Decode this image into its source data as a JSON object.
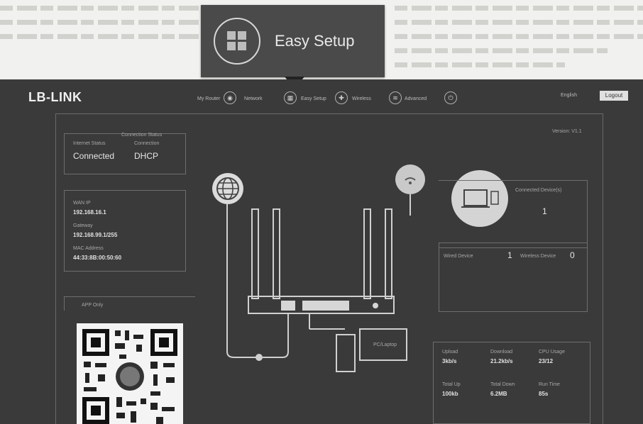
{
  "callout": {
    "label": "Easy Setup"
  },
  "app": {
    "logo": "LB-LINK",
    "nav": [
      {
        "label": "My Router",
        "icon": "router-icon"
      },
      {
        "label": "Network",
        "icon": "network-icon"
      },
      {
        "label": "Easy Setup",
        "icon": "easy-setup-icon"
      },
      {
        "label": "Wireless",
        "icon": "wireless-icon"
      },
      {
        "label": "Advanced",
        "icon": "advanced-icon"
      },
      {
        "label": "Logout",
        "icon": "power-icon"
      }
    ],
    "header_right": "English",
    "lang_button": "Logout"
  },
  "dashboard": {
    "version": "Version: V1.1",
    "internet": {
      "heading": "Connection Status",
      "status_label": "Internet Status",
      "status_value": "Connected",
      "type_label": "Connection",
      "type_value": "DHCP"
    },
    "wan": {
      "ip_label": "WAN IP",
      "ip_value": "192.168.16.1",
      "gateway_label": "Gateway",
      "gateway_value": "192.168.99.1/255",
      "mac_label": "MAC Address",
      "mac_value": "44:33:8B:00:50:60"
    },
    "qr_label": "APP Only",
    "clients": {
      "label": "Connected Device(s)",
      "count": "1"
    },
    "wired": {
      "label": "Wired Device",
      "count": "1",
      "label2": "Wireless Device",
      "count2": "0"
    },
    "stats": {
      "a_label": "Upload",
      "a_value": "3kb/s",
      "b_label": "Download",
      "b_value": "21.2kb/s",
      "c_label": "CPU Usage",
      "c_value": "23/12",
      "d_label": "Total Up",
      "d_value": "100kb",
      "e_label": "Total Down",
      "e_value": "6.2MB",
      "f_label": "Run Time",
      "f_value": "85s"
    },
    "pc_label": "PC/Laptop"
  }
}
